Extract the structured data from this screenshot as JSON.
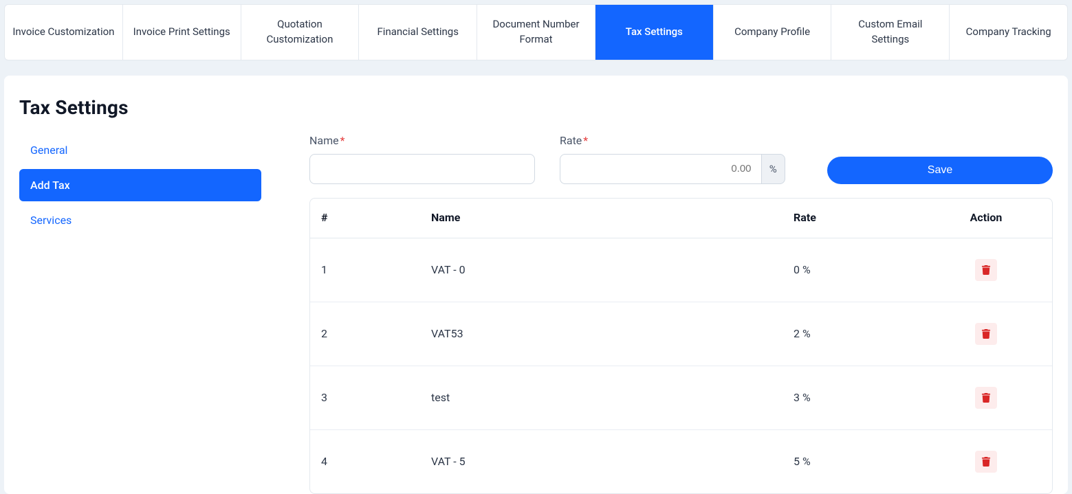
{
  "tabs": [
    {
      "label": "Invoice Customization",
      "active": false
    },
    {
      "label": "Invoice Print Settings",
      "active": false
    },
    {
      "label": "Quotation Customization",
      "active": false
    },
    {
      "label": "Financial Settings",
      "active": false
    },
    {
      "label": "Document Number Format",
      "active": false
    },
    {
      "label": "Tax Settings",
      "active": true
    },
    {
      "label": "Company Profile",
      "active": false
    },
    {
      "label": "Custom Email Settings",
      "active": false
    },
    {
      "label": "Company Tracking",
      "active": false
    }
  ],
  "page_title": "Tax Settings",
  "sidebar": [
    {
      "label": "General",
      "active": false
    },
    {
      "label": "Add Tax",
      "active": true
    },
    {
      "label": "Services",
      "active": false
    }
  ],
  "form": {
    "name_label": "Name",
    "name_value": "",
    "rate_label": "Rate",
    "rate_placeholder": "0.00",
    "rate_addon": "%",
    "save_label": "Save"
  },
  "table": {
    "headers": {
      "index": "#",
      "name": "Name",
      "rate": "Rate",
      "action": "Action"
    },
    "rows": [
      {
        "index": "1",
        "name": "VAT - 0",
        "rate": "0 %"
      },
      {
        "index": "2",
        "name": "VAT53",
        "rate": "2 %"
      },
      {
        "index": "3",
        "name": "test",
        "rate": "3 %"
      },
      {
        "index": "4",
        "name": "VAT - 5",
        "rate": "5 %"
      }
    ]
  }
}
